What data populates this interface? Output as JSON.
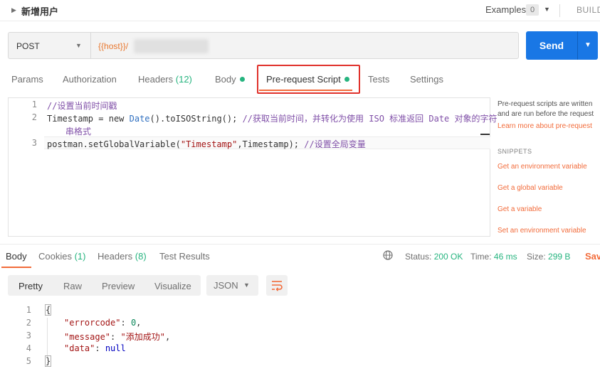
{
  "header": {
    "title": "新增用户",
    "examples_label": "Examples",
    "examples_count": "0",
    "build_label": "BUILD"
  },
  "request": {
    "method": "POST",
    "url": "{{host}}/",
    "send_label": "Send"
  },
  "request_tabs": {
    "params": "Params",
    "authorization": "Authorization",
    "headers": "Headers",
    "headers_count": "(12)",
    "body": "Body",
    "prerequest": "Pre-request Script",
    "tests": "Tests",
    "settings": "Settings"
  },
  "editor": {
    "lines": [
      {
        "num": "1",
        "comment": "//设置当前时间戳"
      },
      {
        "num": "2",
        "var": "Timestamp",
        "op": " = ",
        "kw": "new ",
        "cls": "Date",
        "rest": "().toISOString(); ",
        "comment": "//获取当前时间，并转化为使用 ISO 标准返回 Date 对象的字符",
        "wrap": "串格式"
      },
      {
        "num": "3",
        "obj": "postman.setGlobalVariable(",
        "str": "\"Timestamp\"",
        "rest": ",Timestamp); ",
        "comment": "//设置全局变量"
      }
    ]
  },
  "sidebar": {
    "desc1": "Pre-request scripts are written",
    "desc2": "and are run before the request",
    "learn": "Learn more about pre-request",
    "snippets_header": "SNIPPETS",
    "snippets": [
      "Get an environment variable",
      "Get a global variable",
      "Get a variable",
      "Set an environment variable"
    ]
  },
  "response_tabs": {
    "body": "Body",
    "cookies": "Cookies",
    "cookies_count": "(1)",
    "headers": "Headers",
    "headers_count": "(8)",
    "test_results": "Test Results"
  },
  "status": {
    "status_label": "Status:",
    "status_value": "200 OK",
    "time_label": "Time:",
    "time_value": "46 ms",
    "size_label": "Size:",
    "size_value": "299 B",
    "save_label": "Sav"
  },
  "view_buttons": {
    "pretty": "Pretty",
    "raw": "Raw",
    "preview": "Preview",
    "visualize": "Visualize",
    "format": "JSON"
  },
  "response_body": {
    "line1": {
      "num": "1",
      "text": "{"
    },
    "line2": {
      "num": "2",
      "key": "\"errorcode\"",
      "sep": ": ",
      "val": "0",
      "end": ","
    },
    "line3": {
      "num": "3",
      "key": "\"message\"",
      "sep": ": ",
      "val": "\"添加成功\"",
      "end": ","
    },
    "line4": {
      "num": "4",
      "key": "\"data\"",
      "sep": ": ",
      "val": "null",
      "end": ""
    },
    "line5": {
      "num": "5",
      "text": "}"
    }
  },
  "colors": {
    "accent": "#f26b3a",
    "send": "#1977e5",
    "success": "#26b47f",
    "highlight_box": "#e0312b"
  }
}
